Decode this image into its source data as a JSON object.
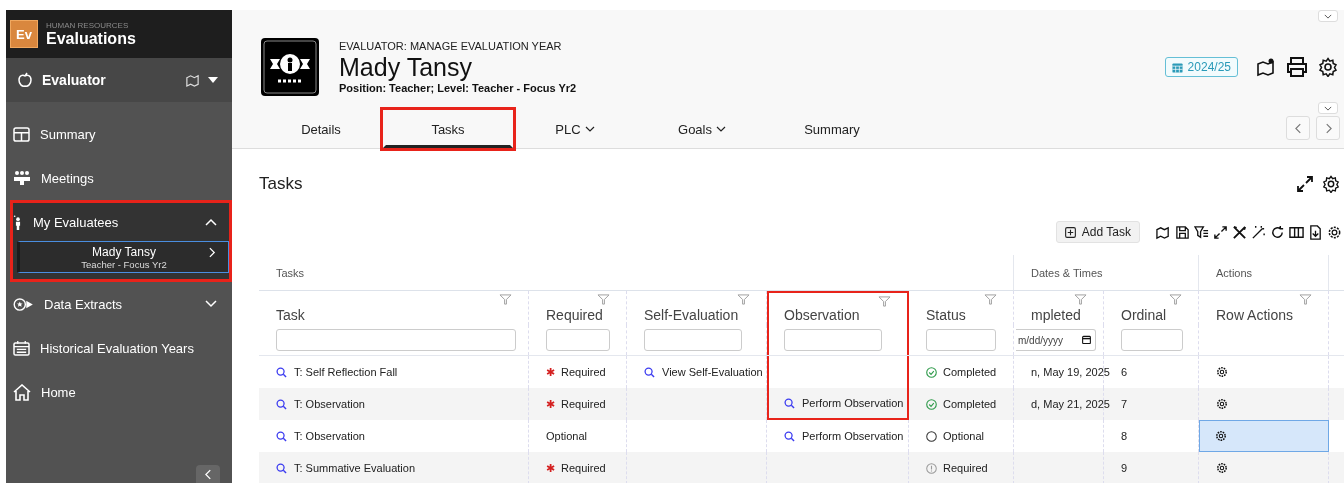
{
  "app": {
    "department": "HUMAN RESOURCES",
    "title": "Evaluations",
    "logo": "Ev"
  },
  "role": {
    "label": "Evaluator"
  },
  "sidebar": {
    "items": [
      {
        "label": "Summary",
        "annotated": false
      },
      {
        "label": "Meetings",
        "annotated": false
      },
      {
        "label": "My Evaluatees",
        "expanded": true,
        "annotated": true,
        "children": [
          {
            "name": "Mady Tansy",
            "detail": "Teacher - Focus Yr2",
            "selected": true
          }
        ]
      },
      {
        "label": "Data Extracts",
        "expanded": false,
        "annotated": false
      },
      {
        "label": "Historical Evaluation Years",
        "annotated": false
      },
      {
        "label": "Home",
        "annotated": false
      }
    ]
  },
  "header": {
    "subtitle": "EVALUATOR: MANAGE EVALUATION YEAR",
    "name": "Mady Tansy",
    "position": "Position: Teacher; Level: Teacher - Focus Yr2",
    "year": "2024/25"
  },
  "tabs": [
    {
      "label": "Details",
      "selected": false,
      "dropdown": false,
      "annotated": false
    },
    {
      "label": "Tasks",
      "selected": true,
      "dropdown": false,
      "annotated": true
    },
    {
      "label": "PLC",
      "selected": false,
      "dropdown": true,
      "annotated": false
    },
    {
      "label": "Goals",
      "selected": false,
      "dropdown": true,
      "annotated": false
    },
    {
      "label": "Summary",
      "selected": false,
      "dropdown": false,
      "annotated": false
    }
  ],
  "section": {
    "title": "Tasks",
    "add_button": "Add Task"
  },
  "table": {
    "groups": [
      {
        "label": "Tasks"
      },
      {
        "label": "Dates & Times"
      },
      {
        "label": "Actions"
      }
    ],
    "columns": [
      {
        "label": "Task",
        "kind": "text",
        "highlighted": false
      },
      {
        "label": "Required",
        "kind": "text",
        "highlighted": false
      },
      {
        "label": "Self-Evaluation",
        "kind": "text",
        "highlighted": false
      },
      {
        "label": "Observation",
        "kind": "text",
        "highlighted": true
      },
      {
        "label": "Status",
        "kind": "text",
        "highlighted": false
      },
      {
        "label": "mpleted",
        "kind": "date",
        "placeholder": "m/dd/yyyy",
        "highlighted": false
      },
      {
        "label": "Ordinal",
        "kind": "text",
        "highlighted": false
      },
      {
        "label": "Row Actions",
        "kind": "none",
        "highlighted": false
      }
    ],
    "rows": [
      {
        "task": "T: Self Reflection Fall",
        "required": {
          "kind": "required",
          "marker": "✱",
          "label": "Required"
        },
        "self_evaluation": "View Self-Evaluation",
        "status": {
          "kind": "completed",
          "label": "Completed"
        },
        "completed": "n, May 19, 2025",
        "ordinal": "6",
        "selected": false,
        "highlighted": true
      },
      {
        "task": "T: Observation",
        "required": {
          "kind": "required",
          "marker": "✱",
          "label": "Required"
        },
        "observation": "Perform Observation",
        "status": {
          "kind": "completed",
          "label": "Completed"
        },
        "completed": "d, May 21, 2025",
        "ordinal": "7",
        "selected": false,
        "highlighted": true
      },
      {
        "task": "T: Observation",
        "required": {
          "kind": "optional",
          "label": "Optional"
        },
        "observation": "Perform Observation",
        "status": {
          "kind": "optional",
          "label": "Optional"
        },
        "ordinal": "8",
        "selected": true,
        "highlighted": false
      },
      {
        "task": "T: Summative Evaluation",
        "required": {
          "kind": "required",
          "marker": "✱",
          "label": "Required"
        },
        "status": {
          "kind": "required",
          "label": "Required"
        },
        "ordinal": "9",
        "selected": false,
        "highlighted": false
      }
    ]
  }
}
